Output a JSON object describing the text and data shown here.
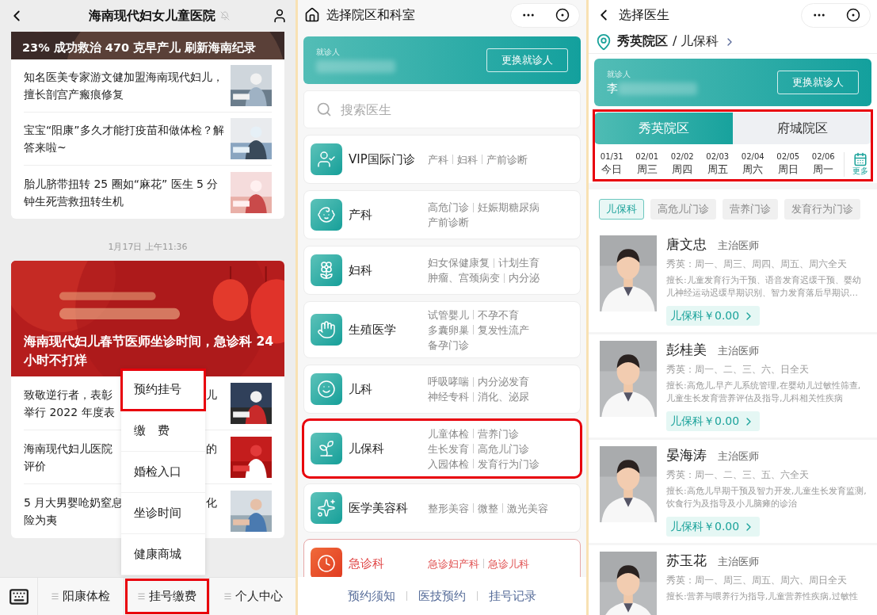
{
  "left": {
    "header": {
      "title": "海南现代妇女儿童医院"
    },
    "top_banner": {
      "caption": "23% 成功救治 470 克早产儿 刷新海南纪录"
    },
    "articles": [
      {
        "title": "知名医美专家游文健加盟海南现代妇儿，擅长剖宫产瘢痕修复"
      },
      {
        "title": "宝宝“阳康”多久才能打疫苗和做体检？解答来啦~"
      },
      {
        "title": "胎儿脐带扭转 25 圈如“麻花” 医生 5 分钟生死营救扭转生机"
      }
    ],
    "timestamp": "1月17日 上午11:36",
    "banner": {
      "caption": "海南现代妇儿春节医师坐诊时间，急诊科 24 小时不打烊"
    },
    "covered_articles": [
      {
        "lines": [
          "致敬逆行者，表彰",
          "举行 2022 年度表"
        ],
        "tail": "儿"
      },
      {
        "lines": [
          "海南现代妇儿医院",
          "评价"
        ],
        "tail": "的"
      },
      {
        "lines": [
          "5 月大男婴呛奶窒息",
          "险为夷"
        ],
        "tail": "化"
      }
    ],
    "popup_menu": [
      {
        "label": "预约挂号",
        "highlighted": true
      },
      {
        "label": "缴　费",
        "highlighted": false
      },
      {
        "label": "婚检入口",
        "highlighted": false
      },
      {
        "label": "坐诊时间",
        "highlighted": false
      },
      {
        "label": "健康商城",
        "highlighted": false
      }
    ],
    "bottom_nav": [
      {
        "label": "阳康体检",
        "highlighted": false
      },
      {
        "label": "挂号缴费",
        "highlighted": true
      },
      {
        "label": "个人中心",
        "highlighted": false
      }
    ]
  },
  "middle": {
    "header": {
      "title": "选择院区和科室"
    },
    "patient": {
      "label": "就诊人",
      "button": "更换就诊人"
    },
    "search": {
      "placeholder": "搜索医生"
    },
    "departments": [
      {
        "name": "VIP国际门诊",
        "kind": "normal",
        "highlighted": false,
        "tags": [
          [
            "产科",
            "妇科",
            "产前诊断"
          ]
        ]
      },
      {
        "name": "产科",
        "kind": "normal",
        "highlighted": false,
        "tags": [
          [
            "高危门诊",
            "妊娠期糖尿病"
          ],
          [
            "产前诊断"
          ]
        ]
      },
      {
        "name": "妇科",
        "kind": "normal",
        "highlighted": false,
        "tags": [
          [
            "妇女保健康复",
            "计划生育"
          ],
          [
            "肿瘤、宫颈病变",
            "内分泌"
          ]
        ]
      },
      {
        "name": "生殖医学",
        "kind": "normal",
        "highlighted": false,
        "tags": [
          [
            "试管婴儿",
            "不孕不育"
          ],
          [
            "多囊卵巢",
            "复发性流产"
          ],
          [
            "备孕门诊"
          ]
        ]
      },
      {
        "name": "儿科",
        "kind": "normal",
        "highlighted": false,
        "tags": [
          [
            "呼吸哮喘",
            "内分泌发育"
          ],
          [
            "神经专科",
            "消化、泌尿"
          ]
        ]
      },
      {
        "name": "儿保科",
        "kind": "normal",
        "highlighted": true,
        "tags": [
          [
            "儿童体检",
            "营养门诊"
          ],
          [
            "生长发育",
            "高危儿门诊"
          ],
          [
            "入园体检",
            "发育行为门诊"
          ]
        ]
      },
      {
        "name": "医学美容科",
        "kind": "normal",
        "highlighted": false,
        "tags": [
          [
            "整形美容",
            "微整",
            "激光美容"
          ]
        ]
      },
      {
        "name": "急诊科",
        "kind": "emergency",
        "highlighted": false,
        "tags": [
          [
            "急诊妇产科",
            "急诊儿科"
          ]
        ]
      }
    ],
    "footer_links": [
      "预约须知",
      "医技预约",
      "挂号记录"
    ]
  },
  "right": {
    "header": {
      "title": "选择医生"
    },
    "location": {
      "campus": "秀英院区",
      "department": "/ 儿保科"
    },
    "patient": {
      "label": "就诊人",
      "name": "李",
      "button": "更换就诊人"
    },
    "campus_selector": {
      "highlighted": true,
      "tabs": [
        {
          "label": "秀英院区",
          "selected": true
        },
        {
          "label": "府城院区",
          "selected": false
        }
      ],
      "dates": [
        {
          "date": "01/31",
          "day": "今日"
        },
        {
          "date": "02/01",
          "day": "周三"
        },
        {
          "date": "02/02",
          "day": "周四"
        },
        {
          "date": "02/03",
          "day": "周五"
        },
        {
          "date": "02/04",
          "day": "周六"
        },
        {
          "date": "02/05",
          "day": "周日"
        },
        {
          "date": "02/06",
          "day": "周一"
        }
      ],
      "more": "更多"
    },
    "chips": [
      {
        "label": "儿保科",
        "selected": true
      },
      {
        "label": "高危儿门诊",
        "selected": false
      },
      {
        "label": "营养门诊",
        "selected": false
      },
      {
        "label": "发育行为门诊",
        "selected": false
      }
    ],
    "doctors": [
      {
        "name": "唐文忠",
        "title": "主治医师",
        "schedule": "秀英：周一、周三、周四、周五、周六全天",
        "specialty": "擅长:儿童发育行为干预、语音发育迟缓干预、婴幼儿神经运动迟缓早期识别、智力发育落后早期识…",
        "fee": "儿保科￥0.00"
      },
      {
        "name": "彭桂美",
        "title": "主治医师",
        "schedule": "秀英：周一、二、三、六、日全天",
        "specialty": "擅长:高危儿,早产儿系统管理,在婴幼儿过敏性筛查,儿童生长发育营养评估及指导,儿科相关性疾病",
        "fee": "儿保科￥0.00"
      },
      {
        "name": "晏海涛",
        "title": "主治医师",
        "schedule": "秀英：周一、二、三、五、六全天",
        "specialty": "擅长:高危儿早期干预及智力开发,儿童生长发育监测,饮食行为及指导及小儿脑瘫的诊治",
        "fee": "儿保科￥0.00"
      },
      {
        "name": "苏玉花",
        "title": "主治医师",
        "schedule": "秀英：周一、周三、周五、周六、周日全天",
        "specialty": "擅长:营养与喂养行为指导,儿童营养性疾病,过敏性"
      }
    ]
  }
}
